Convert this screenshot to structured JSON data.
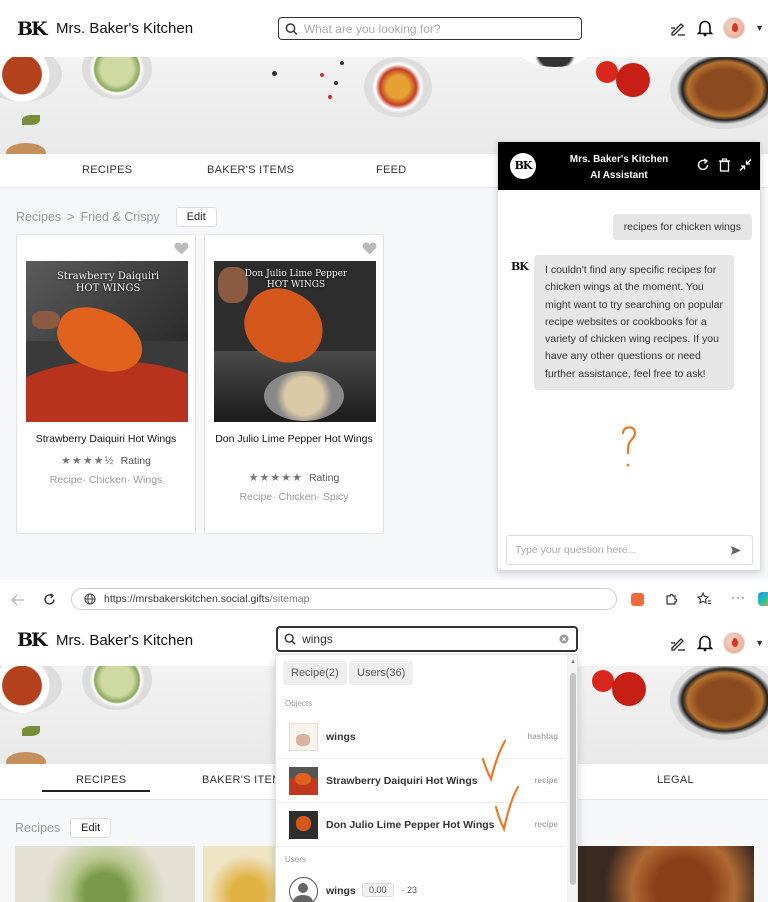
{
  "brand": {
    "logo": "BK",
    "name": "Mrs. Baker's Kitchen"
  },
  "search": {
    "placeholder": "What are you looking for?",
    "value": "wings"
  },
  "nav_top": [
    "RECIPES",
    "BAKER'S ITEMS",
    "FEED"
  ],
  "nav_bottom": [
    "RECIPES",
    "BAKER'S ITEMS",
    "LEGAL"
  ],
  "breadcrumb": {
    "root": "Recipes",
    "separator": ">",
    "current": "Fried & Crispy",
    "edit": "Edit"
  },
  "cards": [
    {
      "title": "Strawberry Daiquiri Hot Wings",
      "rating_label": "Rating",
      "stars": "★★★★½",
      "tags": "Recipe· Chicken· Wings",
      "overlay": "Strawberry Daiquiri HOT WINGS"
    },
    {
      "title": "Don Julio Lime Pepper Hot Wings",
      "rating_label": "Rating",
      "stars": "★★★★★",
      "tags": "Recipe· Chicken· Spicy",
      "overlay": "Don Julio Lime Pepper HOT WINGS"
    }
  ],
  "chat": {
    "title_line1": "Mrs. Baker's Kitchen",
    "title_line2": "AI Assistant",
    "user_message": "recipes for chicken wings",
    "bot_message": "I couldn't find any specific recipes for chicken wings at the moment. You might want to try searching on popular recipe websites or cookbooks for a variety of chicken wing recipes. If you have any other questions or need further assistance, feel free to ask!",
    "input_placeholder": "Type your question here..."
  },
  "browser": {
    "url_host": "https://mrsbakerskitchen.social.gifts",
    "url_path": "/sitemap"
  },
  "dropdown": {
    "tabs": [
      "Recipe(2)",
      "Users(36)"
    ],
    "objects_label": "Objects",
    "users_label": "Users",
    "rows": [
      {
        "label": "wings",
        "kind": "hashtag"
      },
      {
        "label": "Strawberry Daiquiri Hot Wings",
        "kind": "recipe"
      },
      {
        "label": "Don Julio Lime Pepper Hot Wings",
        "kind": "recipe"
      }
    ],
    "user": {
      "name": "wings",
      "score": "0.00",
      "count": "· 23"
    }
  },
  "bottom": {
    "recipes_label": "Recipes",
    "edit": "Edit"
  },
  "colors": {
    "accent_annotation": "#e87a2a",
    "header": "#000000",
    "heart": "#bbbbbb"
  }
}
